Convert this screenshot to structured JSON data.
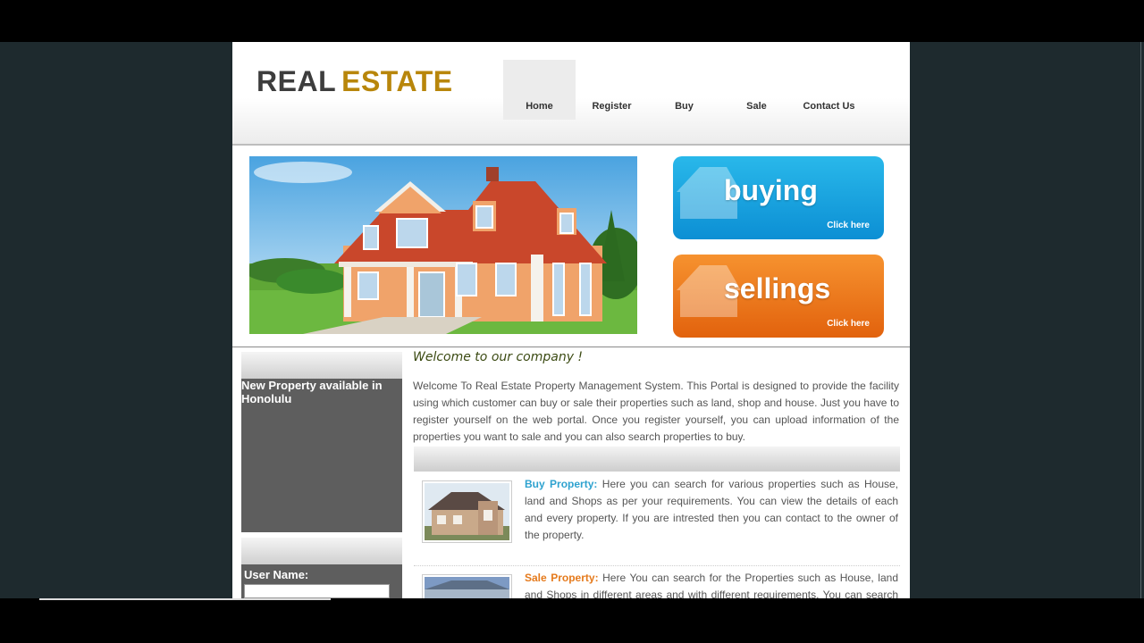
{
  "logo": {
    "part1": "REAL",
    "part2": "ESTATE"
  },
  "nav": [
    {
      "label": "Home"
    },
    {
      "label": "Register"
    },
    {
      "label": "Buy"
    },
    {
      "label": "Sale"
    },
    {
      "label": "Contact Us"
    }
  ],
  "promos": {
    "buying": {
      "title": "buying",
      "cta": "Click here"
    },
    "selling": {
      "title": "sellings",
      "cta": "Click here"
    }
  },
  "sidebar": {
    "new_property": "New Property available in Honolulu",
    "username_label": "User Name:"
  },
  "main": {
    "welcome": "Welcome to our company !",
    "intro": "Welcome To Real Estate Property Management System. This Portal is designed to provide the facility using which customer can buy or sale their properties such as land, shop and house. Just you have to register yourself on the web portal. Once you register yourself, you can upload information of the properties you want to sale and you can also search properties to buy.",
    "buy_heading": "Buy Property:",
    "buy_text": " Here you can search for various properties such as House, land and Shops as per your requirements. You can view the details of each and every property. If you are intrested then you can contact to the owner of the property.",
    "sale_heading": "Sale Property:",
    "sale_text": " Here You can search for the Properties such as House, land and Shops in different areas and with different requirements. You can search all kind"
  },
  "colors": {
    "buy_blue": "#1aa6e2",
    "sell_orange": "#ee7a1f",
    "logo_gold": "#b8860b"
  }
}
